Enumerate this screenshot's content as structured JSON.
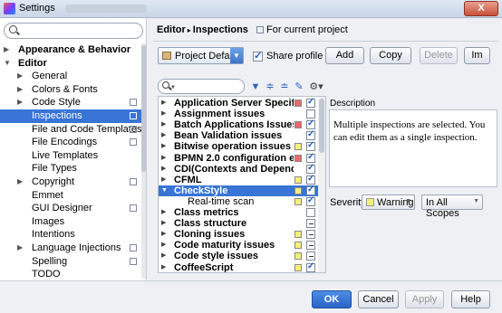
{
  "window": {
    "title": "Settings",
    "close_glyph": "X"
  },
  "sidebar": {
    "search_placeholder": "",
    "items": [
      {
        "label": "Appearance & Behavior",
        "level": 0,
        "arrow": "right",
        "bold": true,
        "copy": false
      },
      {
        "label": "Editor",
        "level": 0,
        "arrow": "down",
        "bold": true,
        "copy": false
      },
      {
        "label": "General",
        "level": 1,
        "arrow": "right",
        "bold": false,
        "copy": false
      },
      {
        "label": "Colors & Fonts",
        "level": 1,
        "arrow": "right",
        "bold": false,
        "copy": false
      },
      {
        "label": "Code Style",
        "level": 1,
        "arrow": "right",
        "bold": false,
        "copy": true
      },
      {
        "label": "Inspections",
        "level": 1,
        "arrow": "",
        "bold": false,
        "copy": true,
        "selected": true
      },
      {
        "label": "File and Code Templates",
        "level": 1,
        "arrow": "",
        "bold": false,
        "copy": true
      },
      {
        "label": "File Encodings",
        "level": 1,
        "arrow": "",
        "bold": false,
        "copy": true
      },
      {
        "label": "Live Templates",
        "level": 1,
        "arrow": "",
        "bold": false,
        "copy": false
      },
      {
        "label": "File Types",
        "level": 1,
        "arrow": "",
        "bold": false,
        "copy": false
      },
      {
        "label": "Copyright",
        "level": 1,
        "arrow": "right",
        "bold": false,
        "copy": true
      },
      {
        "label": "Emmet",
        "level": 1,
        "arrow": "",
        "bold": false,
        "copy": false
      },
      {
        "label": "GUI Designer",
        "level": 1,
        "arrow": "",
        "bold": false,
        "copy": true
      },
      {
        "label": "Images",
        "level": 1,
        "arrow": "",
        "bold": false,
        "copy": false
      },
      {
        "label": "Intentions",
        "level": 1,
        "arrow": "",
        "bold": false,
        "copy": false
      },
      {
        "label": "Language Injections",
        "level": 1,
        "arrow": "right",
        "bold": false,
        "copy": true
      },
      {
        "label": "Spelling",
        "level": 1,
        "arrow": "",
        "bold": false,
        "copy": true
      },
      {
        "label": "TODO",
        "level": 1,
        "arrow": "",
        "bold": false,
        "copy": false
      }
    ]
  },
  "breadcrumb": {
    "part1": "Editor",
    "sep": "▸",
    "part2": "Inspections",
    "scope": "For current project"
  },
  "profile": {
    "selected": "Project Default",
    "share_label": "Share profile",
    "share_checked": true,
    "add_label": "Add",
    "copy_label": "Copy",
    "delete_label": "Delete",
    "import_label": "Im"
  },
  "filter": {
    "placeholder": ""
  },
  "colors": {
    "error": "#e86a6a",
    "warning": "#f5f07a",
    "accent": "#3875d6"
  },
  "tree": [
    {
      "label": "Application Server Specific Ins",
      "arrow": "right",
      "sev": "error",
      "check": "on"
    },
    {
      "label": "Assignment issues",
      "arrow": "right",
      "sev": "",
      "check": "off"
    },
    {
      "label": "Batch Applications Issues",
      "arrow": "right",
      "sev": "error",
      "check": "on"
    },
    {
      "label": "Bean Validation issues",
      "arrow": "right",
      "sev": "",
      "check": "on"
    },
    {
      "label": "Bitwise operation issues",
      "arrow": "right",
      "sev": "warning",
      "check": "on"
    },
    {
      "label": "BPMN 2.0 configuration errors",
      "arrow": "right",
      "sev": "error",
      "check": "on"
    },
    {
      "label": "CDI(Contexts and Dependency",
      "arrow": "right",
      "sev": "",
      "check": "on"
    },
    {
      "label": "CFML",
      "arrow": "right",
      "sev": "warning",
      "check": "on"
    },
    {
      "label": "CheckStyle",
      "arrow": "down",
      "sev": "warning",
      "check": "on",
      "selected": true
    },
    {
      "label": "Real-time scan",
      "arrow": "",
      "sev": "warning",
      "check": "on",
      "child": true
    },
    {
      "label": "Class metrics",
      "arrow": "right",
      "sev": "",
      "check": "off"
    },
    {
      "label": "Class structure",
      "arrow": "right",
      "sev": "",
      "check": "partial"
    },
    {
      "label": "Cloning issues",
      "arrow": "right",
      "sev": "warning",
      "check": "partial"
    },
    {
      "label": "Code maturity issues",
      "arrow": "right",
      "sev": "warning",
      "check": "partial"
    },
    {
      "label": "Code style issues",
      "arrow": "right",
      "sev": "warning",
      "check": "partial"
    },
    {
      "label": "CoffeeScript",
      "arrow": "right",
      "sev": "warning",
      "check": "on"
    }
  ],
  "description": {
    "title": "Description",
    "text": "Multiple inspections are selected. You can edit them as a single inspection."
  },
  "severity": {
    "label": "Severity:",
    "value": "Warning",
    "scope": "In All Scopes"
  },
  "footer": {
    "ok": "OK",
    "cancel": "Cancel",
    "apply": "Apply",
    "help": "Help"
  }
}
